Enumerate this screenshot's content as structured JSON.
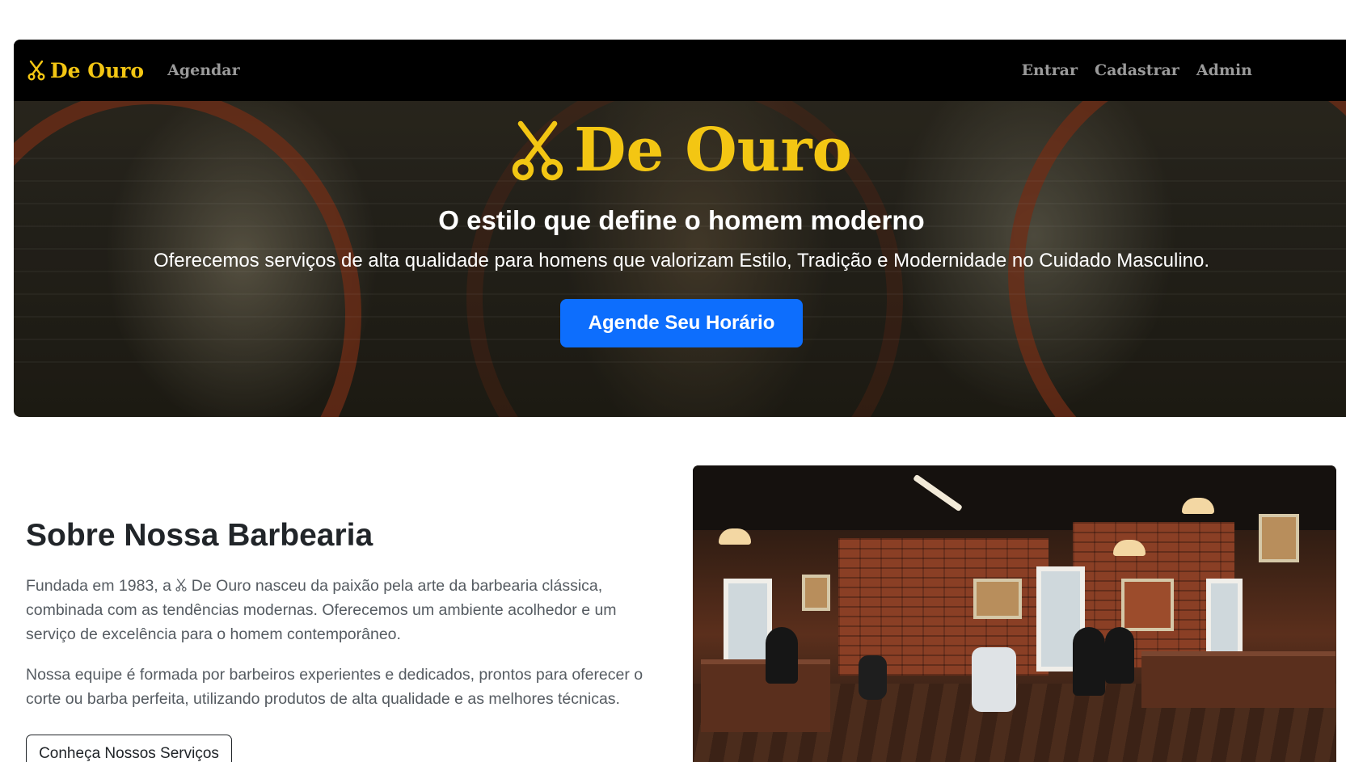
{
  "navbar": {
    "brand": "De Ouro",
    "brand_icon": "scissors-icon",
    "links_left": [
      "Agendar"
    ],
    "links_right": [
      "Entrar",
      "Cadastrar",
      "Admin"
    ]
  },
  "hero": {
    "title": "De Ouro",
    "title_icon": "scissors-icon",
    "subtitle": "O estilo que define o homem moderno",
    "lead": "Oferecemos serviços de alta qualidade para homens que valorizam Estilo, Tradição e Modernidade no Cuidado Masculino.",
    "cta_label": "Agende Seu Horário"
  },
  "about": {
    "title": "Sobre Nossa Barbearia",
    "p1_before": "Fundada em 1983, a ",
    "p1_after": " De Ouro nasceu da paixão pela arte da barbearia clássica, combinada com as tendências modernas. Oferecemos um ambiente acolhedor e um serviço de excelência para o homem contemporâneo.",
    "p2": "Nossa equipe é formada por barbeiros experientes e dedicados, prontos para oferecer o corte ou barba perfeita, utilizando produtos de alta qualidade e as melhores técnicas.",
    "button_label": "Conheça Nossos Serviços"
  },
  "colors": {
    "brand_gold": "#f3c613",
    "primary_blue": "#0d6efd",
    "navbar_bg": "#000000",
    "text_dark": "#212529",
    "text_muted": "#555b61"
  }
}
